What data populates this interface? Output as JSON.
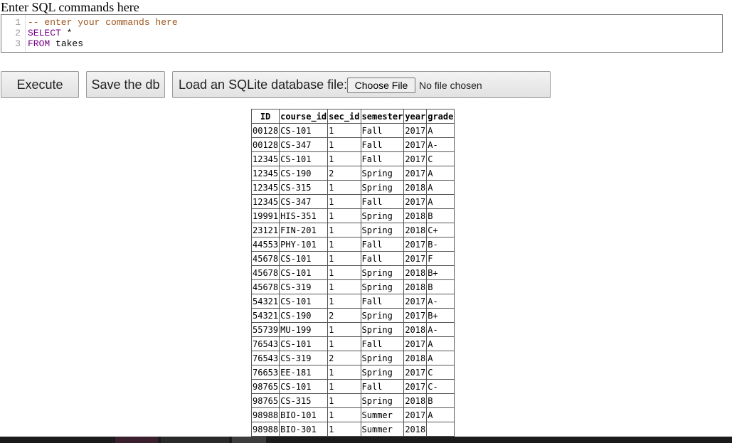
{
  "page": {
    "label": "Enter SQL commands here"
  },
  "editor": {
    "lines": [
      {
        "num": "1",
        "tokens": [
          {
            "t": "-- enter your commands here",
            "c": "comment"
          }
        ]
      },
      {
        "num": "2",
        "tokens": [
          {
            "t": "SELECT",
            "c": "kw"
          },
          {
            "t": " *",
            "c": "op"
          }
        ]
      },
      {
        "num": "3",
        "tokens": [
          {
            "t": "FROM",
            "c": "kw"
          },
          {
            "t": " takes",
            "c": "ident"
          }
        ]
      }
    ]
  },
  "buttons": {
    "execute": "Execute",
    "save": "Save the db"
  },
  "loader": {
    "label": "Load an SQLite database file:",
    "choose": "Choose File",
    "status": "No file chosen"
  },
  "results": {
    "columns": [
      "ID",
      "course_id",
      "sec_id",
      "semester",
      "year",
      "grade"
    ],
    "rows": [
      [
        "00128",
        "CS-101",
        "1",
        "Fall",
        "2017",
        "A"
      ],
      [
        "00128",
        "CS-347",
        "1",
        "Fall",
        "2017",
        "A-"
      ],
      [
        "12345",
        "CS-101",
        "1",
        "Fall",
        "2017",
        "C"
      ],
      [
        "12345",
        "CS-190",
        "2",
        "Spring",
        "2017",
        "A"
      ],
      [
        "12345",
        "CS-315",
        "1",
        "Spring",
        "2018",
        "A"
      ],
      [
        "12345",
        "CS-347",
        "1",
        "Fall",
        "2017",
        "A"
      ],
      [
        "19991",
        "HIS-351",
        "1",
        "Spring",
        "2018",
        "B"
      ],
      [
        "23121",
        "FIN-201",
        "1",
        "Spring",
        "2018",
        "C+"
      ],
      [
        "44553",
        "PHY-101",
        "1",
        "Fall",
        "2017",
        "B-"
      ],
      [
        "45678",
        "CS-101",
        "1",
        "Fall",
        "2017",
        "F"
      ],
      [
        "45678",
        "CS-101",
        "1",
        "Spring",
        "2018",
        "B+"
      ],
      [
        "45678",
        "CS-319",
        "1",
        "Spring",
        "2018",
        "B"
      ],
      [
        "54321",
        "CS-101",
        "1",
        "Fall",
        "2017",
        "A-"
      ],
      [
        "54321",
        "CS-190",
        "2",
        "Spring",
        "2017",
        "B+"
      ],
      [
        "55739",
        "MU-199",
        "1",
        "Spring",
        "2018",
        "A-"
      ],
      [
        "76543",
        "CS-101",
        "1",
        "Fall",
        "2017",
        "A"
      ],
      [
        "76543",
        "CS-319",
        "2",
        "Spring",
        "2018",
        "A"
      ],
      [
        "76653",
        "EE-181",
        "1",
        "Spring",
        "2017",
        "C"
      ],
      [
        "98765",
        "CS-101",
        "1",
        "Fall",
        "2017",
        "C-"
      ],
      [
        "98765",
        "CS-315",
        "1",
        "Spring",
        "2018",
        "B"
      ],
      [
        "98988",
        "BIO-101",
        "1",
        "Summer",
        "2017",
        "A"
      ],
      [
        "98988",
        "BIO-301",
        "1",
        "Summer",
        "2018",
        ""
      ]
    ]
  },
  "colors": {
    "comment": "#a0561a",
    "keyword": "#770088",
    "taskbar": "#1b1b1b"
  }
}
